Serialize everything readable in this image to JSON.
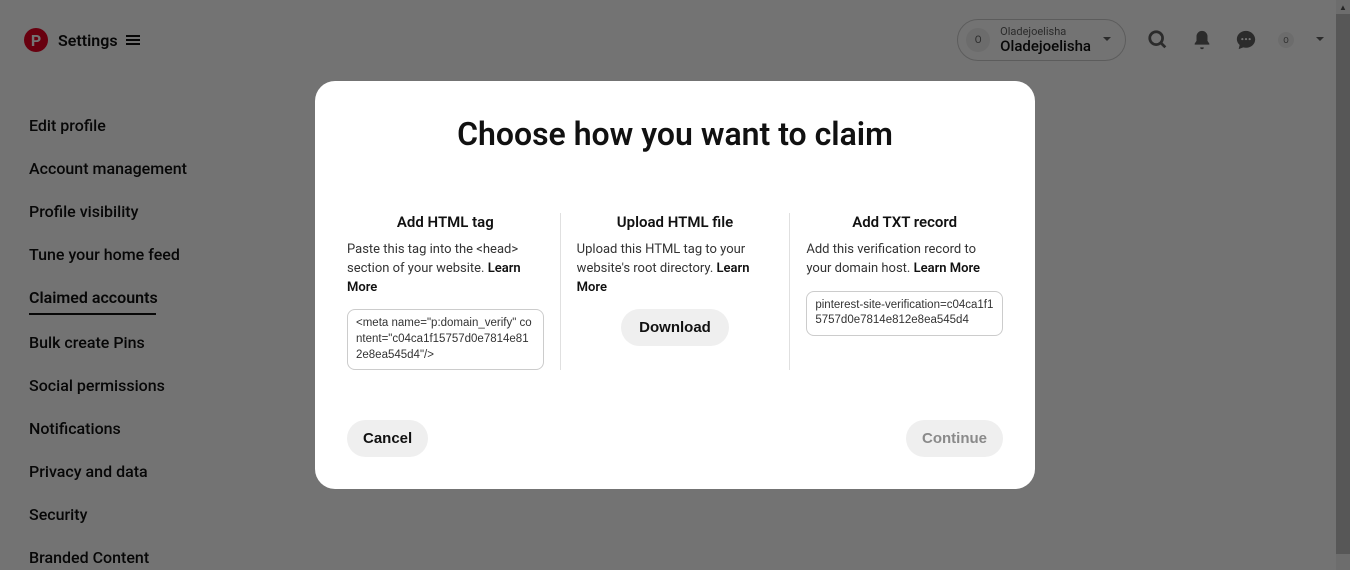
{
  "header": {
    "settings_label": "Settings",
    "account_small": "Oladejoelisha",
    "account_name": "Oladejoelisha",
    "avatar_letter": "O"
  },
  "sidebar": {
    "items": [
      {
        "label": "Edit profile"
      },
      {
        "label": "Account management"
      },
      {
        "label": "Profile visibility"
      },
      {
        "label": "Tune your home feed"
      },
      {
        "label": "Claimed accounts"
      },
      {
        "label": "Bulk create Pins"
      },
      {
        "label": "Social permissions"
      },
      {
        "label": "Notifications"
      },
      {
        "label": "Privacy and data"
      },
      {
        "label": "Security"
      },
      {
        "label": "Branded Content"
      }
    ],
    "active_index": 4
  },
  "modal": {
    "title": "Choose how you want to claim",
    "options": {
      "html_tag": {
        "title": "Add HTML tag",
        "desc": "Paste this tag into the <head> section of your website. ",
        "learn_more": "Learn More",
        "code": "<meta name=\"p:domain_verify\" content=\"c04ca1f15757d0e7814e812e8ea545d4\"/>"
      },
      "upload": {
        "title": "Upload HTML file",
        "desc": "Upload this HTML tag to your website's root directory. ",
        "learn_more": "Learn More",
        "button": "Download"
      },
      "txt": {
        "title": "Add TXT record",
        "desc": "Add this verification record to your domain host. ",
        "learn_more": "Learn More",
        "code": "pinterest-site-verification=c04ca1f15757d0e7814e812e8ea545d4"
      }
    },
    "cancel_label": "Cancel",
    "continue_label": "Continue"
  }
}
